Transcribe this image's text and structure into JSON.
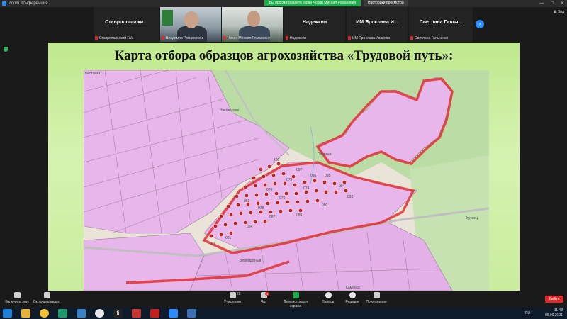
{
  "window": {
    "app_title": "Zoom Конференция",
    "viewing_banner": "Вы просматриваете экран Чохин Михаил Романович",
    "view_options": "Настройки просмотра",
    "controls": [
      "—",
      "□",
      "✕"
    ]
  },
  "participants": [
    {
      "type": "name",
      "name": "Ставропольски...",
      "label": "Ставропольский ГАУ"
    },
    {
      "type": "video",
      "name": "",
      "label": "Владимир Романенков"
    },
    {
      "type": "video",
      "name": "",
      "label": "Чохин Михаил Романович"
    },
    {
      "type": "name",
      "name": "Надежкин",
      "label": "Надежкин"
    },
    {
      "type": "name",
      "name": "ИМ Ярослава И...",
      "label": "ИМ Ярослава Иванова"
    },
    {
      "type": "name",
      "name": "Светлана Гальч...",
      "label": "Светлана Гальченко"
    }
  ],
  "strip_view_label": "Вид",
  "slide": {
    "title": "Карта отбора образцов агрохозяйства «Трудовой путь»:",
    "map_labels": {
      "top_left": "Бестянка",
      "village1": "Никольское",
      "village2": "Поселки",
      "village3": "Кузнец",
      "village4": "Благодатный",
      "village5": "Каменка"
    },
    "sample_labels": [
      "100",
      "097",
      "096",
      "095",
      "094",
      "093",
      "090",
      "089",
      "087",
      "084",
      "081",
      "079",
      "078",
      "076",
      "074",
      "073",
      "070",
      "069"
    ]
  },
  "toolbar": {
    "audio": "Включить звук",
    "video": "Включить видео",
    "participants": "Участники",
    "participants_count": "28",
    "chat": "Чат",
    "chat_badge": "1",
    "share": "Демонстрация экрана",
    "record": "Запись",
    "reactions": "Реакции",
    "apps": "Приложения",
    "leave": "Выйти"
  },
  "taskbar": {
    "lang": "RU",
    "time": "11:48",
    "date": "08.09.2021"
  },
  "colors": {
    "parcel": "#e7b6ea",
    "farm_outline": "#e03030",
    "forest": "#b9dba3",
    "slide_bg": "#c9ec9e"
  }
}
